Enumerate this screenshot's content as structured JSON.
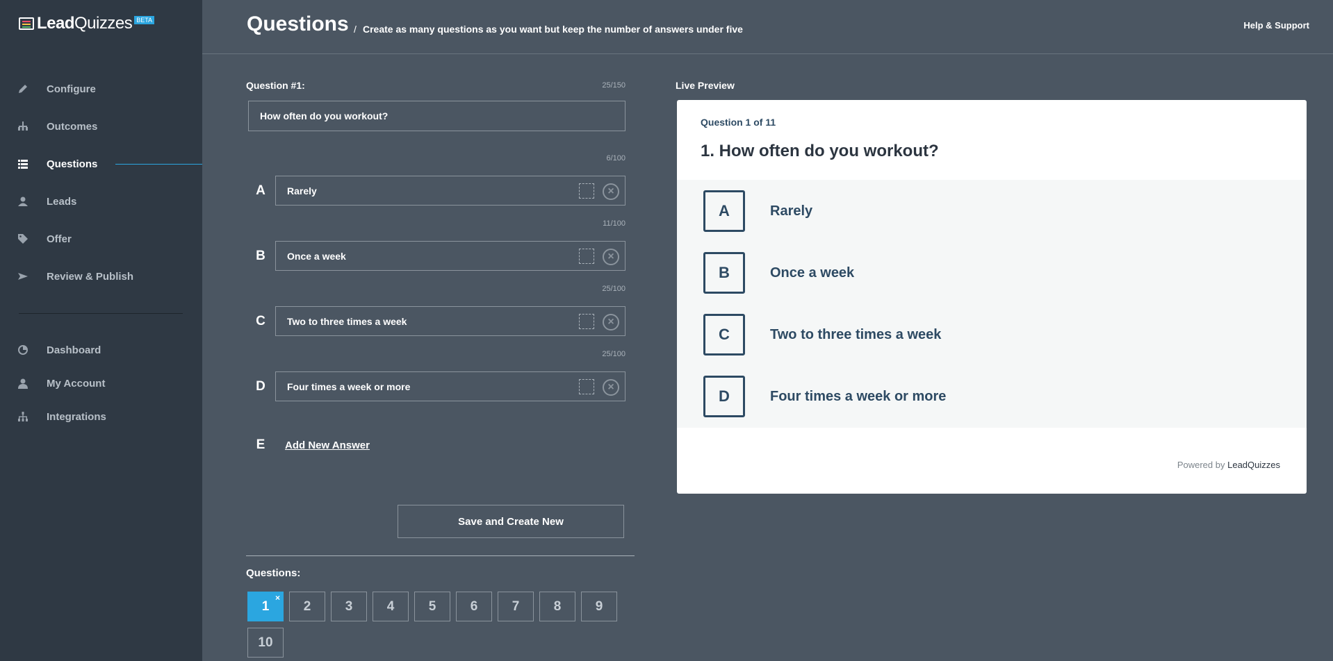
{
  "brand": {
    "name_bold": "Lead",
    "name_light": "Quizzes",
    "badge": "BETA"
  },
  "nav": {
    "main": [
      {
        "label": "Configure",
        "icon": "pencil-icon"
      },
      {
        "label": "Outcomes",
        "icon": "hierarchy-icon"
      },
      {
        "label": "Questions",
        "icon": "list-icon",
        "active": true
      },
      {
        "label": "Leads",
        "icon": "users-icon"
      },
      {
        "label": "Offer",
        "icon": "tag-icon"
      },
      {
        "label": "Review & Publish",
        "icon": "send-icon"
      }
    ],
    "secondary": [
      {
        "label": "Dashboard",
        "icon": "pie-chart-icon"
      },
      {
        "label": "My Account",
        "icon": "user-icon"
      },
      {
        "label": "Integrations",
        "icon": "sitemap-icon"
      }
    ]
  },
  "header": {
    "title": "Questions",
    "separator": "/",
    "subtitle": "Create as many questions as you want but keep the number of answers under five",
    "help": "Help & Support"
  },
  "editor": {
    "question_label": "Question #1:",
    "question_counter": "25/150",
    "question_value": "How often do you workout?",
    "answers": [
      {
        "letter": "A",
        "text": "Rarely",
        "counter": "6/100"
      },
      {
        "letter": "B",
        "text": "Once a week",
        "counter": "11/100"
      },
      {
        "letter": "C",
        "text": "Two to three times a week",
        "counter": "25/100"
      },
      {
        "letter": "D",
        "text": "Four times a week or more",
        "counter": "25/100"
      }
    ],
    "new_letter": "E",
    "add_answer": "Add New Answer",
    "save_button": "Save and Create New",
    "questions_label": "Questions:",
    "question_numbers": [
      "1",
      "2",
      "3",
      "4",
      "5",
      "6",
      "7",
      "8",
      "9",
      "10"
    ],
    "remove_glyph": "×"
  },
  "preview": {
    "label": "Live Preview",
    "count": "Question 1 of 11",
    "question": "1. How often do you workout?",
    "answers": [
      {
        "letter": "A",
        "text": "Rarely"
      },
      {
        "letter": "B",
        "text": "Once a week"
      },
      {
        "letter": "C",
        "text": "Two to three times a week"
      },
      {
        "letter": "D",
        "text": "Four times a week or more"
      }
    ],
    "powered_prefix": "Powered by",
    "powered_brand": "LeadQuizzes"
  },
  "colors": {
    "accent": "#2ba6e0",
    "sidebar": "#2f3944",
    "background": "#4b5662",
    "preview_text": "#2d4a63"
  }
}
